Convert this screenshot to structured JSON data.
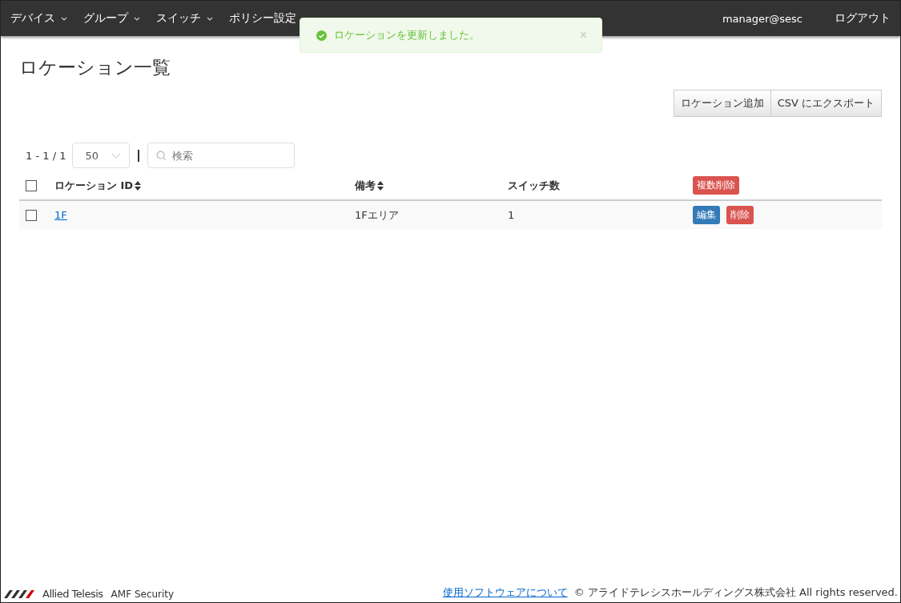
{
  "nav": {
    "items": [
      {
        "label": "デバイス",
        "dropdown": true
      },
      {
        "label": "グループ",
        "dropdown": true
      },
      {
        "label": "スイッチ",
        "dropdown": true
      },
      {
        "label": "ポリシー設定",
        "dropdown": false
      }
    ],
    "user": "manager@sesc",
    "logout": "ログアウト"
  },
  "toast": {
    "message": "ロケーションを更新しました。",
    "close": "×"
  },
  "page_title": "ロケーション一覧",
  "actions": [
    "ロケーション追加",
    "CSV にエクスポート"
  ],
  "pager": {
    "range": "1 - 1 / 1",
    "page_size": "50",
    "search_placeholder": "検索"
  },
  "table": {
    "columns": [
      {
        "label": "ロケーション ID",
        "sortable": true
      },
      {
        "label": "備考",
        "sortable": true
      },
      {
        "label": "スイッチ数",
        "sortable": false
      }
    ],
    "bulk_delete": "複数削除",
    "select_all": false,
    "rows": [
      {
        "id": "1F",
        "note": "1Fエリア",
        "switches": "1",
        "checked": false,
        "edit": "編集",
        "delete": "削除"
      }
    ]
  },
  "footer": {
    "brand": "Allied Telesis",
    "product": "AMF Security",
    "link": "使用ソフトウェアについて",
    "copyright": "© アライドテレシスホールディングス株式会社 All rights reserved."
  }
}
